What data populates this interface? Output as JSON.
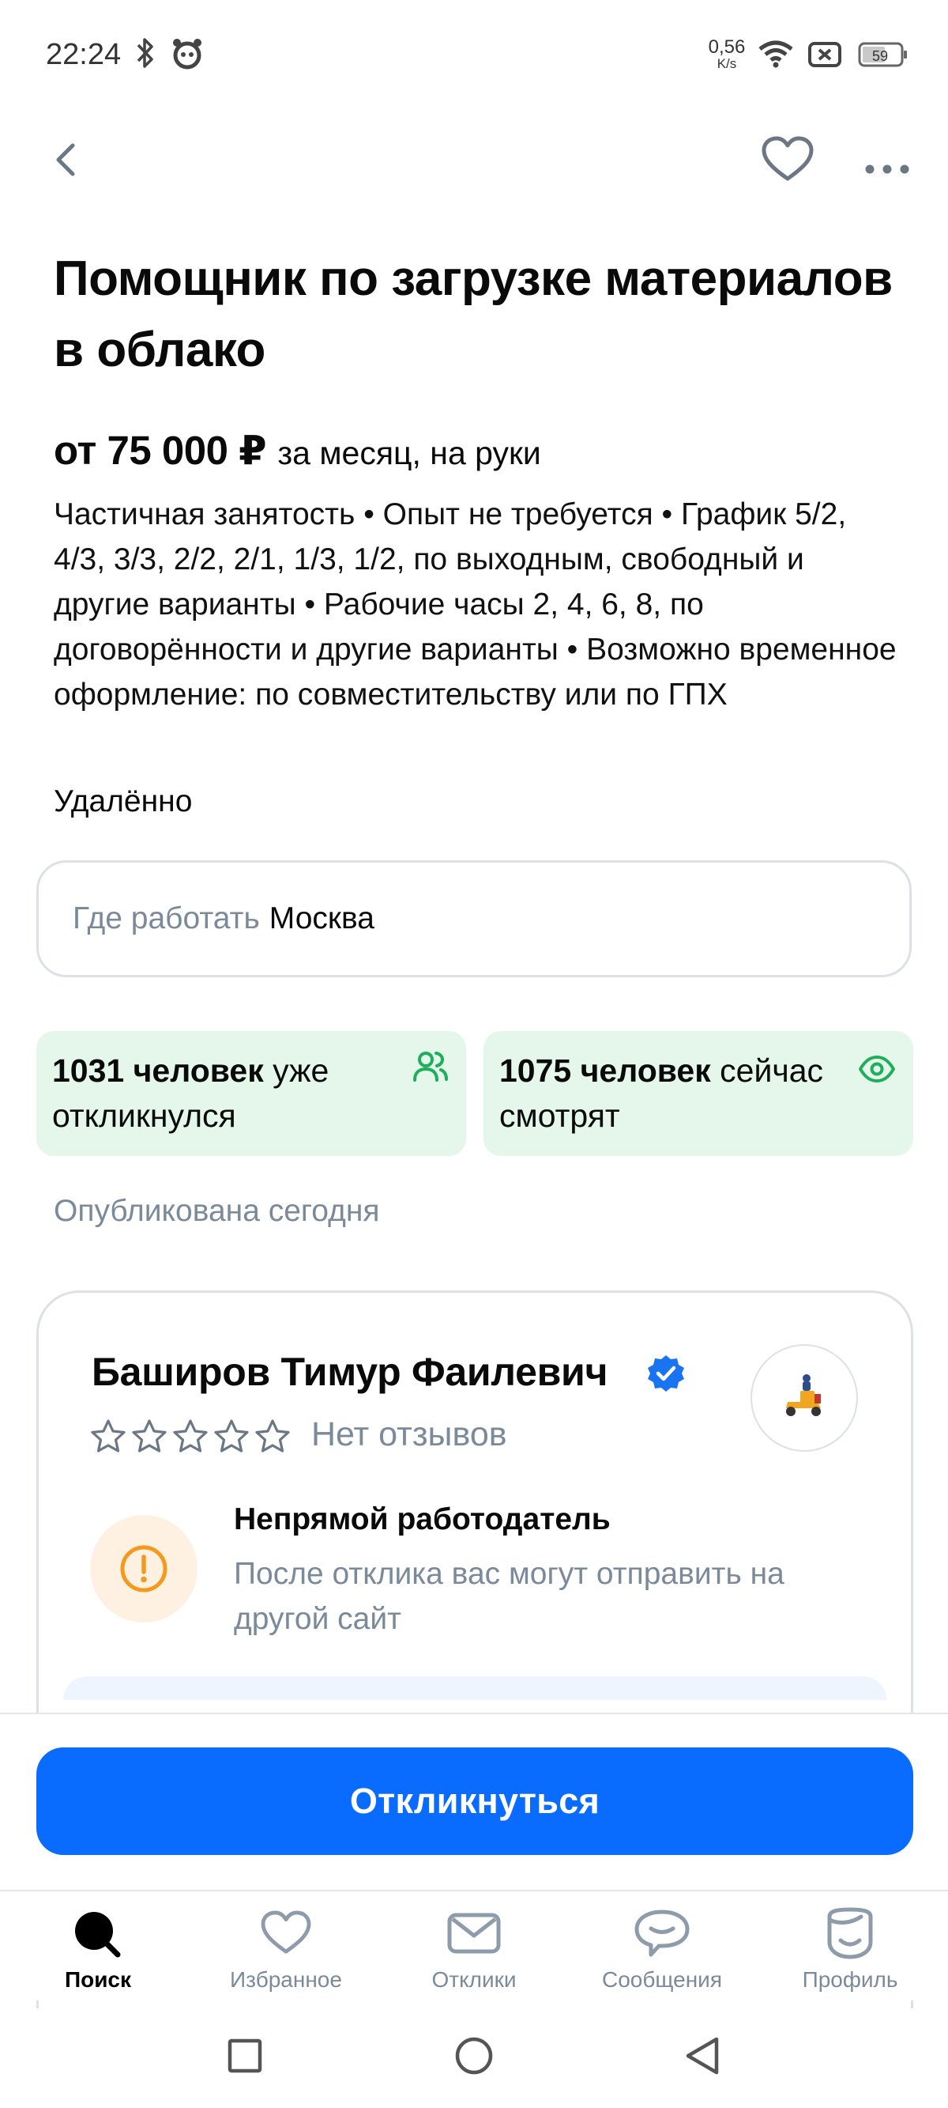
{
  "status_bar": {
    "time": "22:24",
    "net_speed_value": "0,56",
    "net_speed_unit": "K/s",
    "battery": "59",
    "icons": [
      "bluetooth-icon",
      "pet-app-icon",
      "wifi-icon",
      "sim-off-icon",
      "battery-icon"
    ]
  },
  "top_bar": {
    "icons": [
      "back-arrow-icon",
      "favorite-heart-icon",
      "more-dots-icon"
    ]
  },
  "vacancy": {
    "title": "Помощник по загрузке материалов в облако",
    "salary_amount": "от 75 000 ₽",
    "salary_suffix": "за месяц, на руки",
    "details": "Частичная занятость • Опыт не требуется • График 5/2, 4/3, 3/3, 2/2, 2/1, 1/3, 1/2, по выходным, свободный и другие варианты • Рабочие часы 2, 4, 6, 8, по договорённости и другие варианты • Возможно временное оформление: по совместительству или по ГПХ",
    "work_format": "Удалённо",
    "location_label": "Где работать",
    "location_value": "Москва",
    "published": "Опубликована сегодня"
  },
  "stats": {
    "responded_count": "1031 человек",
    "responded_text": "уже откликнулся",
    "viewing_count": "1075 человек",
    "viewing_text": "сейчас смотрят",
    "accent_color": "#1fae5b"
  },
  "employer": {
    "name": "Баширов Тимур Фаилевич",
    "reviews": "Нет отзывов",
    "rating_stars": 0,
    "warning_title": "Непрямой работодатель",
    "warning_text": "После отклика вас могут отправить на другой сайт",
    "warning_color": "#f39a1e"
  },
  "apply_button": {
    "label": "Откликнуться",
    "color": "#0a6cff"
  },
  "tabs": [
    {
      "label": "Поиск",
      "icon": "search-icon",
      "active": true
    },
    {
      "label": "Избранное",
      "icon": "heart-icon",
      "active": false
    },
    {
      "label": "Отклики",
      "icon": "envelope-icon",
      "active": false
    },
    {
      "label": "Сообщения",
      "icon": "chat-bubble-icon",
      "active": false
    },
    {
      "label": "Профиль",
      "icon": "profile-face-icon",
      "active": false
    }
  ],
  "system_nav": [
    "recent-apps-icon",
    "home-icon",
    "back-triangle-icon"
  ]
}
